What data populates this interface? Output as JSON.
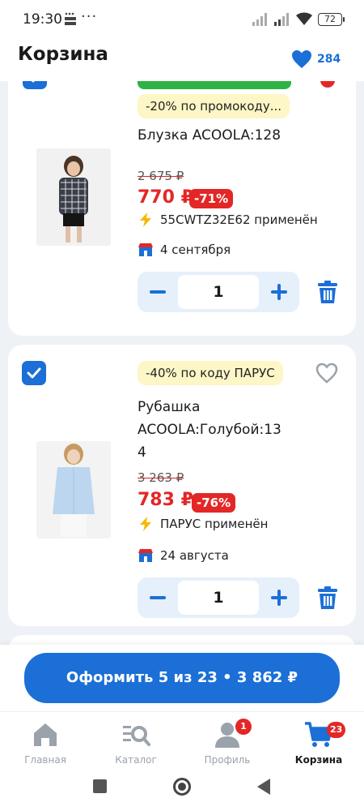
{
  "status_bar": {
    "time": "19:30",
    "dots": "···",
    "battery": "72"
  },
  "header": {
    "title": "Корзина",
    "favorites_count": "284"
  },
  "items": [
    {
      "promo": "-20% по промокоду...",
      "title_lines": [
        "Блузка ACOOLA:128"
      ],
      "old_price": "2 675 ₽",
      "price": "770 ₽",
      "discount": "-71%",
      "applied": "55CWTZ32E62 применён",
      "delivery": "4 сентября",
      "quantity": "1"
    },
    {
      "promo": "-40% по коду ПАРУС",
      "title_lines": [
        "Рубашка",
        "ACOOLA:Голубой:13",
        "4"
      ],
      "old_price": "3 263 ₽",
      "price": "783 ₽",
      "discount": "-76%",
      "applied": "ПАРУС применён",
      "delivery": "24 августа",
      "quantity": "1"
    }
  ],
  "checkout": {
    "label": "Оформить 5 из 23 • 3 862 ₽"
  },
  "bottom_nav": [
    {
      "label": "Главная",
      "icon": "home-icon"
    },
    {
      "label": "Каталог",
      "icon": "catalog-search-icon"
    },
    {
      "label": "Профиль",
      "icon": "profile-icon",
      "badge": "1"
    },
    {
      "label": "Корзина",
      "icon": "cart-icon",
      "badge": "23",
      "active": true
    }
  ],
  "colors": {
    "accent": "#1b6fd6",
    "price_red": "#e32726",
    "promo_bg": "#fdf6c6",
    "page_bg": "#eef2f6"
  }
}
